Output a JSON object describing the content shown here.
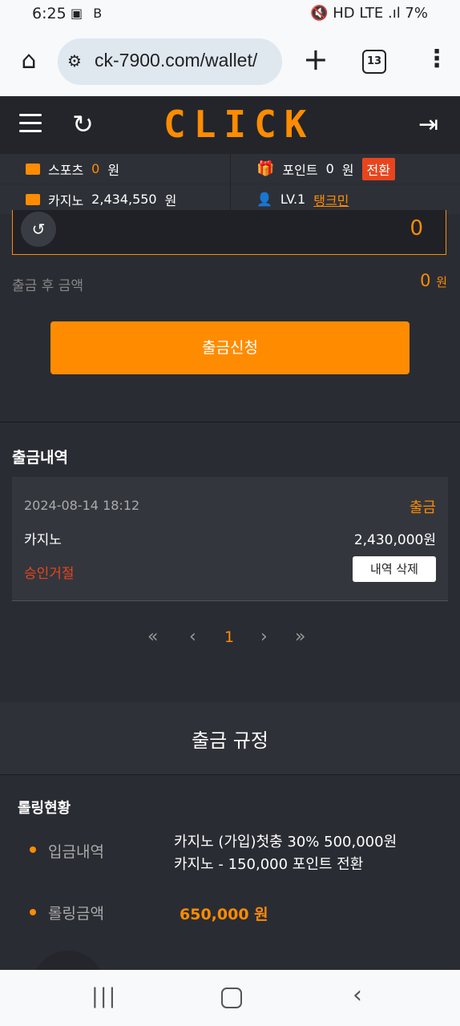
{
  "status_bar": {
    "time": "6:25",
    "left_icons": "▣ B",
    "right": "🔇 HD LTE .ıl 7%"
  },
  "browser": {
    "url": "ck-7900.com/wallet/",
    "tab_count": "13"
  },
  "header": {
    "logo": "CLICK"
  },
  "info": {
    "sports_label": "스포츠",
    "sports_value": "0",
    "sports_unit": "원",
    "point_label": "포인트",
    "point_value": "0",
    "point_unit": "원",
    "convert_label": "전환",
    "casino_label": "카지노",
    "casino_value": "2,434,550",
    "casino_unit": "원",
    "level": "LV.1",
    "username": "탱크민"
  },
  "form": {
    "amount": "0",
    "after_label": "출금 후 금액",
    "after_value": "0",
    "after_unit": "원",
    "submit_label": "출금신청"
  },
  "history": {
    "title": "출금내역",
    "items": [
      {
        "date": "2024-08-14 18:12",
        "type": "출금",
        "category": "카지노",
        "amount": "2,430,000원",
        "status": "승인거절",
        "delete_label": "내역 삭제"
      }
    ],
    "pagination": {
      "first": "«",
      "prev": "‹",
      "current": "1",
      "next": "›",
      "last": "»"
    }
  },
  "rules": {
    "title": "출금 규정",
    "rolling_title": "롤링현황",
    "deposit_label": "입금내역",
    "deposit_line1": "카지노 (가입)첫충 30% 500,000원",
    "deposit_line2": "카지노 - 150,000 포인트 전환",
    "rolling_label": "롤링금액",
    "rolling_value": "650,000 원"
  },
  "colors": {
    "accent": "#ff8c00",
    "danger": "#e8451d",
    "bg": "#2a2c33"
  }
}
